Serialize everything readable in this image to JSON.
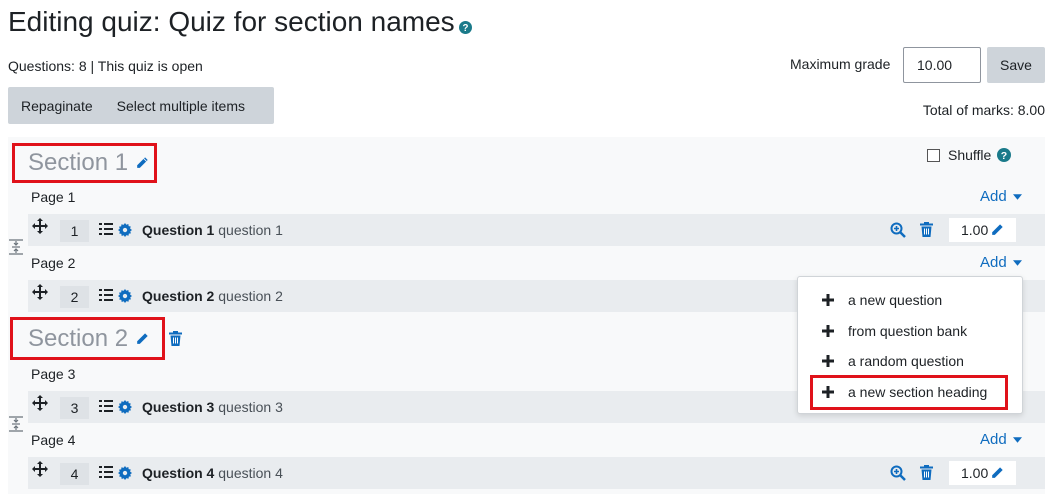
{
  "header": {
    "title": "Editing quiz: Quiz for section names",
    "status": "Questions: 8 | This quiz is open",
    "max_grade_label": "Maximum grade",
    "max_grade_value": "10.00",
    "save_label": "Save",
    "total_marks": "Total of marks: 8.00"
  },
  "toolbar": {
    "repaginate_label": "Repaginate",
    "select_multiple_label": "Select multiple items"
  },
  "sections": [
    {
      "title": "Section 1",
      "shuffle_label": "Shuffle"
    },
    {
      "title": "Section 2"
    }
  ],
  "pages": [
    {
      "label": "Page 1",
      "add_label": "Add"
    },
    {
      "label": "Page 2",
      "add_label": "Add"
    },
    {
      "label": "Page 3"
    },
    {
      "label": "Page 4",
      "add_label": "Add"
    }
  ],
  "questions": [
    {
      "number": "1",
      "name": "Question 1",
      "text": "question 1",
      "mark": "1.00"
    },
    {
      "number": "2",
      "name": "Question 2",
      "text": "question 2"
    },
    {
      "number": "3",
      "name": "Question 3",
      "text": "question 3"
    },
    {
      "number": "4",
      "name": "Question 4",
      "text": "question 4",
      "mark": "1.00"
    }
  ],
  "add_menu": {
    "items": [
      "a new question",
      "from question bank",
      "a random question",
      "a new section heading"
    ],
    "highlighted_index": 3
  },
  "colors": {
    "accent": "#0f6cbf",
    "highlight_border": "#e0121a",
    "help_icon": "#1a7a8a"
  },
  "icons": {
    "move": "move-icon",
    "list": "list-icon",
    "settings": "cog-icon",
    "preview": "zoom-icon",
    "delete": "trash-icon",
    "edit": "pencil-icon",
    "help": "help-icon",
    "add": "plus-icon",
    "join": "join-icon"
  }
}
